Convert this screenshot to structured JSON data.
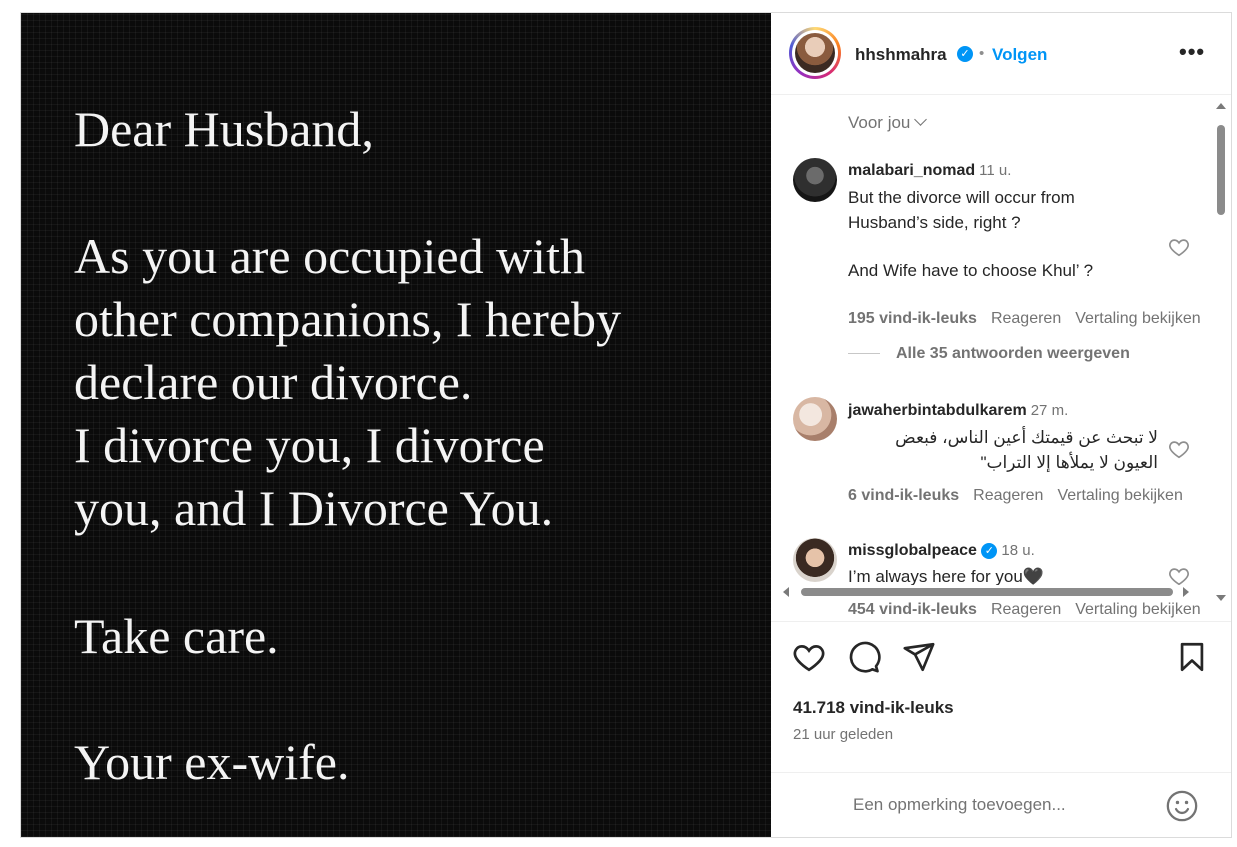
{
  "post_image": {
    "lines": [
      "Dear Husband,",
      "As you are occupied with",
      "other companions, I hereby",
      "declare our divorce.",
      "I divorce you, I divorce",
      "you, and I Divorce You.",
      "Take care.",
      "Your ex-wife."
    ]
  },
  "header": {
    "username": "hhshmahra",
    "verified": "verified-badge-icon",
    "separator": "•",
    "follow_label": "Volgen",
    "more_label": "•••"
  },
  "comments_section": {
    "sort_label": "Voor jou",
    "view_replies_label": "Alle 35 antwoorden weergeven",
    "comments": [
      {
        "user": "malabari_nomad",
        "time": "11 u.",
        "text_lines": [
          "But the divorce will occur from",
          "Husband’s side, right ?",
          "",
          "And Wife have to choose Khul’ ?"
        ],
        "likes": "195 vind-ik-leuks",
        "reply": "Reageren",
        "translate": "Vertaling bekijken"
      },
      {
        "user": "jawaherbintabdulkarem",
        "time": "27 m.",
        "text_lines": [
          "لا تبحث عن قيمتك أعين الناس، فبعض",
          "العيون لا يملأها إلا التراب\""
        ],
        "likes": "6 vind-ik-leuks",
        "reply": "Reageren",
        "translate": "Vertaling bekijken"
      },
      {
        "user": "missglobalpeace",
        "time": "18 u.",
        "text_lines": [
          "I’m always here for you🖤"
        ],
        "likes": "454 vind-ik-leuks",
        "reply": "Reageren",
        "translate": "Vertaling bekijken"
      }
    ]
  },
  "actions": {
    "like_icon": "heart-icon",
    "comment_icon": "comment-icon",
    "share_icon": "paper-plane-icon",
    "save_icon": "bookmark-icon",
    "like_count": "41.718 vind-ik-leuks",
    "time_ago": "21 uur geleden"
  },
  "comment_box": {
    "placeholder": "Een opmerking toevoegen...",
    "emoji_icon": "smiley-icon"
  },
  "colors": {
    "accent": "#0095f6",
    "muted": "#737373",
    "image_bg": "#0b0b0b"
  }
}
